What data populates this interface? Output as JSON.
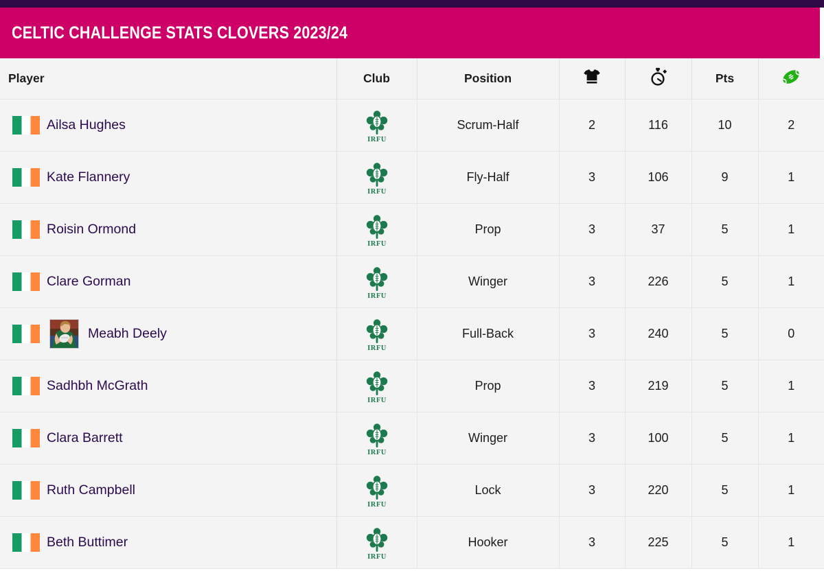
{
  "banner": {
    "title": "CELTIC CHALLENGE STATS CLOVERS 2023/24",
    "accent_pink": "#cc0066",
    "accent_dark": "#2d0a45"
  },
  "table": {
    "columns": [
      {
        "key": "player",
        "label": "Player",
        "icon": null
      },
      {
        "key": "club",
        "label": "Club",
        "icon": null
      },
      {
        "key": "position",
        "label": "Position",
        "icon": null
      },
      {
        "key": "apps",
        "label": "",
        "icon": "jersey-icon"
      },
      {
        "key": "minutes",
        "label": "",
        "icon": "stopwatch-icon"
      },
      {
        "key": "points",
        "label": "Pts",
        "icon": null
      },
      {
        "key": "tries",
        "label": "",
        "icon": "rugby-ball-icon"
      }
    ],
    "club_logo_label": "IRFU",
    "rows": [
      {
        "player": "Ailsa Hughes",
        "flag": "ireland",
        "avatar": false,
        "club": "IRFU",
        "position": "Scrum-Half",
        "apps": "2",
        "minutes": "116",
        "points": "10",
        "tries": "2"
      },
      {
        "player": "Kate Flannery",
        "flag": "ireland",
        "avatar": false,
        "club": "IRFU",
        "position": "Fly-Half",
        "apps": "3",
        "minutes": "106",
        "points": "9",
        "tries": "1"
      },
      {
        "player": "Roisin Ormond",
        "flag": "ireland",
        "avatar": false,
        "club": "IRFU",
        "position": "Prop",
        "apps": "3",
        "minutes": "37",
        "points": "5",
        "tries": "1"
      },
      {
        "player": "Clare Gorman",
        "flag": "ireland",
        "avatar": false,
        "club": "IRFU",
        "position": "Winger",
        "apps": "3",
        "minutes": "226",
        "points": "5",
        "tries": "1"
      },
      {
        "player": "Meabh Deely",
        "flag": "ireland",
        "avatar": true,
        "club": "IRFU",
        "position": "Full-Back",
        "apps": "3",
        "minutes": "240",
        "points": "5",
        "tries": "0"
      },
      {
        "player": "Sadhbh McGrath",
        "flag": "ireland",
        "avatar": false,
        "club": "IRFU",
        "position": "Prop",
        "apps": "3",
        "minutes": "219",
        "points": "5",
        "tries": "1"
      },
      {
        "player": "Clara Barrett",
        "flag": "ireland",
        "avatar": false,
        "club": "IRFU",
        "position": "Winger",
        "apps": "3",
        "minutes": "100",
        "points": "5",
        "tries": "1"
      },
      {
        "player": "Ruth Campbell",
        "flag": "ireland",
        "avatar": false,
        "club": "IRFU",
        "position": "Lock",
        "apps": "3",
        "minutes": "220",
        "points": "5",
        "tries": "1"
      },
      {
        "player": "Beth Buttimer",
        "flag": "ireland",
        "avatar": false,
        "club": "IRFU",
        "position": "Hooker",
        "apps": "3",
        "minutes": "225",
        "points": "5",
        "tries": "1"
      }
    ]
  },
  "colors": {
    "player_name": "#2b0a4d",
    "row_bg": "#f4f4f4",
    "flag_green": "#169b62",
    "flag_orange": "#ff883e",
    "logo_green": "#1d7a4c",
    "ball_green": "#22b014"
  }
}
